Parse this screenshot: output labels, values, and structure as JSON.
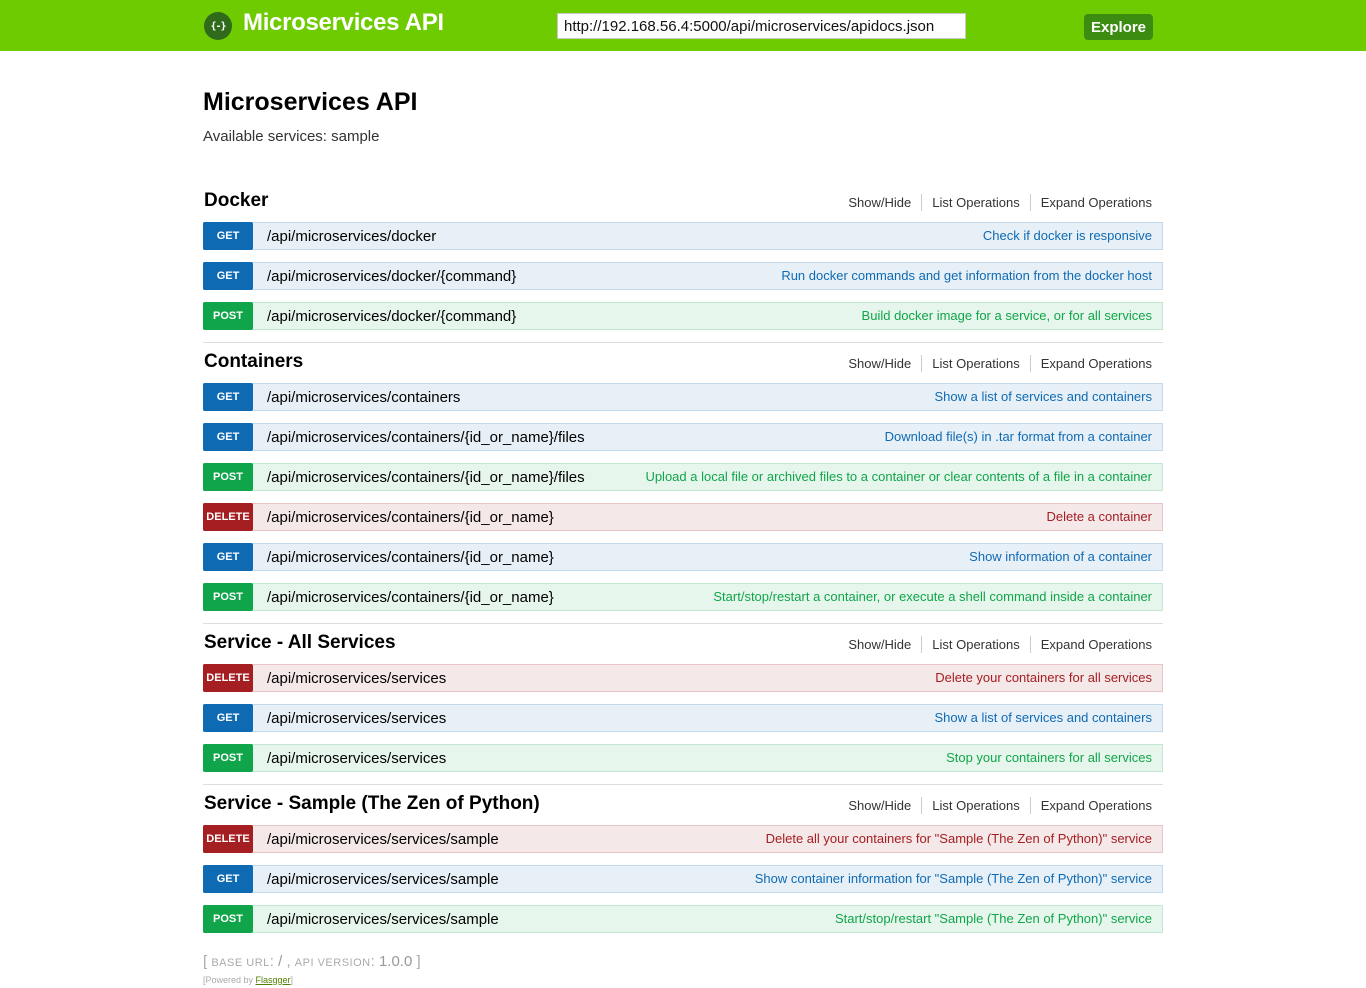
{
  "header": {
    "logo_glyph": "{-}",
    "title": "Microservices API",
    "url_value": "http://192.168.56.4:5000/api/microservices/apidocs.json",
    "explore_label": "Explore"
  },
  "info": {
    "title": "Microservices API",
    "description": "Available services: sample"
  },
  "resource_links": {
    "show_hide": "Show/Hide",
    "list_operations": "List Operations",
    "expand_operations": "Expand Operations"
  },
  "resources": [
    {
      "title": "Docker",
      "operations": [
        {
          "method": "GET",
          "path": "/api/microservices/docker",
          "summary": "Check if docker is responsive"
        },
        {
          "method": "GET",
          "path": "/api/microservices/docker/{command}",
          "summary": "Run docker commands and get information from the docker host"
        },
        {
          "method": "POST",
          "path": "/api/microservices/docker/{command}",
          "summary": "Build docker image for a service, or for all services"
        }
      ]
    },
    {
      "title": "Containers",
      "operations": [
        {
          "method": "GET",
          "path": "/api/microservices/containers",
          "summary": "Show a list of services and containers"
        },
        {
          "method": "GET",
          "path": "/api/microservices/containers/{id_or_name}/files",
          "summary": "Download file(s) in .tar format from a container"
        },
        {
          "method": "POST",
          "path": "/api/microservices/containers/{id_or_name}/files",
          "summary": "Upload a local file or archived files to a container or clear contents of a file in a container"
        },
        {
          "method": "DELETE",
          "path": "/api/microservices/containers/{id_or_name}",
          "summary": "Delete a container"
        },
        {
          "method": "GET",
          "path": "/api/microservices/containers/{id_or_name}",
          "summary": "Show information of a container"
        },
        {
          "method": "POST",
          "path": "/api/microservices/containers/{id_or_name}",
          "summary": "Start/stop/restart a container, or execute a shell command inside a container"
        }
      ]
    },
    {
      "title": "Service - All Services",
      "operations": [
        {
          "method": "DELETE",
          "path": "/api/microservices/services",
          "summary": "Delete your containers for all services"
        },
        {
          "method": "GET",
          "path": "/api/microservices/services",
          "summary": "Show a list of services and containers"
        },
        {
          "method": "POST",
          "path": "/api/microservices/services",
          "summary": "Stop your containers for all services"
        }
      ]
    },
    {
      "title": "Service - Sample (The Zen of Python)",
      "operations": [
        {
          "method": "DELETE",
          "path": "/api/microservices/services/sample",
          "summary": "Delete all your containers for \"Sample (The Zen of Python)\" service"
        },
        {
          "method": "GET",
          "path": "/api/microservices/services/sample",
          "summary": "Show container information for \"Sample (The Zen of Python)\" service"
        },
        {
          "method": "POST",
          "path": "/api/microservices/services/sample",
          "summary": "Start/stop/restart \"Sample (The Zen of Python)\" service"
        }
      ]
    }
  ],
  "footer": {
    "open_bracket": "[",
    "base_url_label": "BASE URL",
    "base_url_value": "/",
    "api_version_label": "API VERSION",
    "api_version_value": "1.0.0",
    "close_bracket": "]",
    "powered_prefix": "[Powered by ",
    "powered_link": "Flasgger",
    "powered_suffix": "]"
  },
  "colors": {
    "header_bg": "#6dcb00",
    "get": "#0f6ab4",
    "post": "#10a54a",
    "delete": "#a41e22"
  }
}
